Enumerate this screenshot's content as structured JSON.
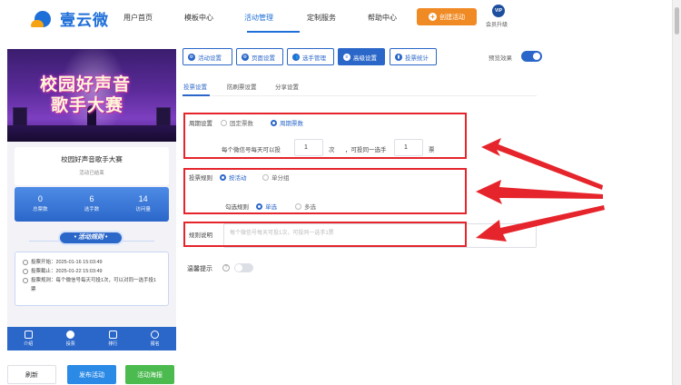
{
  "header": {
    "logo_text": "壹云微",
    "nav": [
      "用户首页",
      "模板中心",
      "活动管理",
      "定制服务",
      "帮助中心"
    ],
    "create_button": "创建活动",
    "vip_badge": "VIP",
    "vip_label": "会员升级"
  },
  "preview": {
    "banner_line1": "校园好声音",
    "banner_line2": "歌手大赛",
    "title": "校园好声音歌手大赛",
    "status": "活动已结束",
    "stats": [
      {
        "value": "0",
        "label": "总票数"
      },
      {
        "value": "6",
        "label": "选手数"
      },
      {
        "value": "14",
        "label": "访问量"
      }
    ],
    "rules_button": "• 活动规则 •",
    "rules": [
      "投票开始：2025-01-16 15:03:49",
      "投票截止：2025-01-22 15:03:49",
      "投票规则：每个微信号每天可投1次，可以对同一选手投1票"
    ],
    "bottom_nav": [
      "介绍",
      "投票",
      "排行",
      "报名"
    ]
  },
  "actions": {
    "refresh": "刷新",
    "publish": "发布活动",
    "poster": "活动海报"
  },
  "toolbar": [
    "活动设置",
    "页面设置",
    "选手管理",
    "高级设置",
    "投票统计"
  ],
  "effect": {
    "label": "预览效果",
    "on": true
  },
  "subtabs": [
    "投票设置",
    "防刷票设置",
    "分享设置"
  ],
  "form": {
    "cycle_label": "周期设置",
    "cycle_options": [
      "固定票数",
      "周期票数"
    ],
    "cycle_text_prefix": "每个微信号每天可以投",
    "cycle_value": "1",
    "cycle_unit": "次",
    "cycle_text_mid": "，可投同一选手",
    "cycle_value2": "1",
    "cycle_unit2": "票",
    "vote_rule_label": "投票规则",
    "vote_rule_options": [
      "按活动",
      "单分组"
    ],
    "check_rule_label": "勾选规则",
    "check_rule_options": [
      "单选",
      "多选"
    ],
    "rule_desc_label": "规则说明",
    "rule_desc_placeholder": "每个微信号每天可投1次，可投同一选手1票",
    "tip_label": "温馨提示",
    "tip_help": "?"
  },
  "colors": {
    "primary": "#2b67c9",
    "accent": "#f08a24",
    "highlight": "#e5242b",
    "green": "#4cbb4f"
  }
}
